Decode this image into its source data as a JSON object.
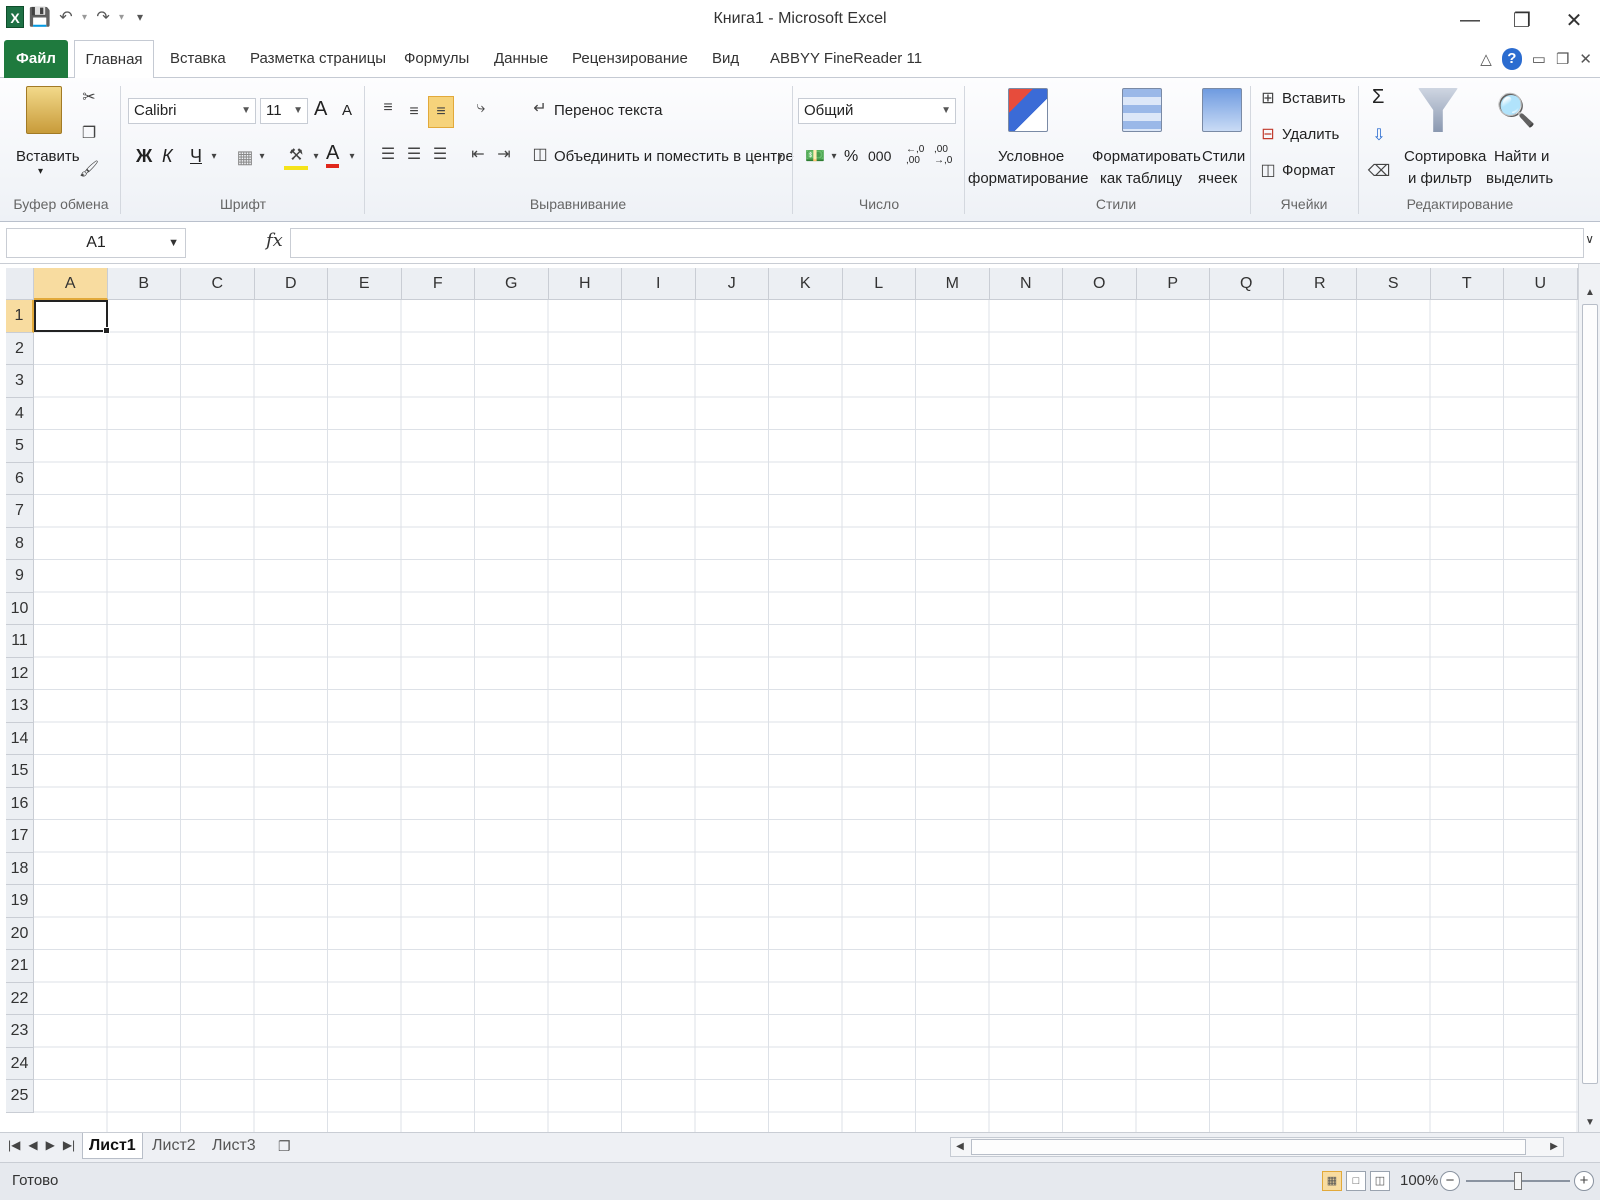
{
  "window": {
    "title": "Книга1  -  Microsoft Excel",
    "minimize": "—",
    "restore": "❐",
    "close": "✕"
  },
  "tabs": {
    "file": "Файл",
    "home": "Главная",
    "insert": "Вставка",
    "page_layout": "Разметка страницы",
    "formulas": "Формулы",
    "data": "Данные",
    "review": "Рецензирование",
    "view": "Вид",
    "abbyy": "ABBYY FineReader 11"
  },
  "ribbon": {
    "clipboard": {
      "paste": "Вставить",
      "label": "Буфер обмена"
    },
    "font": {
      "name": "Calibri",
      "size": "11",
      "bold": "Ж",
      "italic": "К",
      "underline": "Ч",
      "font_color": "А",
      "grow": "A",
      "shrink": "A",
      "label": "Шрифт"
    },
    "alignment": {
      "wrap_text": "Перенос текста",
      "merge_center": "Объединить и поместить в центре",
      "label": "Выравнивание"
    },
    "number": {
      "format": "Общий",
      "percent": "%",
      "thousands": "000",
      "inc_decimal": "←,0 ,00",
      "dec_decimal": ",00 →,0",
      "label": "Число"
    },
    "styles": {
      "conditional_1": "Условное",
      "conditional_2": "форматирование",
      "format_table_1": "Форматировать",
      "format_table_2": "как таблицу",
      "cell_styles_1": "Стили",
      "cell_styles_2": "ячеек",
      "label": "Стили"
    },
    "cells": {
      "insert": "Вставить",
      "delete": "Удалить",
      "format": "Формат",
      "label": "Ячейки"
    },
    "editing": {
      "sigma": "Σ",
      "sort_1": "Сортировка",
      "sort_2": "и фильтр",
      "find_1": "Найти и",
      "find_2": "выделить",
      "label": "Редактирование"
    }
  },
  "formula_bar": {
    "name_box": "A1",
    "fx": "fx",
    "value": ""
  },
  "grid": {
    "columns": [
      "A",
      "B",
      "C",
      "D",
      "E",
      "F",
      "G",
      "H",
      "I",
      "J",
      "K",
      "L",
      "M",
      "N",
      "O",
      "P",
      "Q",
      "R",
      "S",
      "T",
      "U"
    ],
    "rows": [
      "1",
      "2",
      "3",
      "4",
      "5",
      "6",
      "7",
      "8",
      "9",
      "10",
      "11",
      "12",
      "13",
      "14",
      "15",
      "16",
      "17",
      "18",
      "19",
      "20",
      "21",
      "22",
      "23",
      "24",
      "25"
    ],
    "active_cell": "A1"
  },
  "sheets": [
    "Лист1",
    "Лист2",
    "Лист3"
  ],
  "status": {
    "ready": "Готово",
    "zoom": "100%"
  },
  "colors": {
    "file_tab": "#1f7a3e",
    "selection_header": "#f8dca0",
    "gridline": "#dde1e7"
  }
}
